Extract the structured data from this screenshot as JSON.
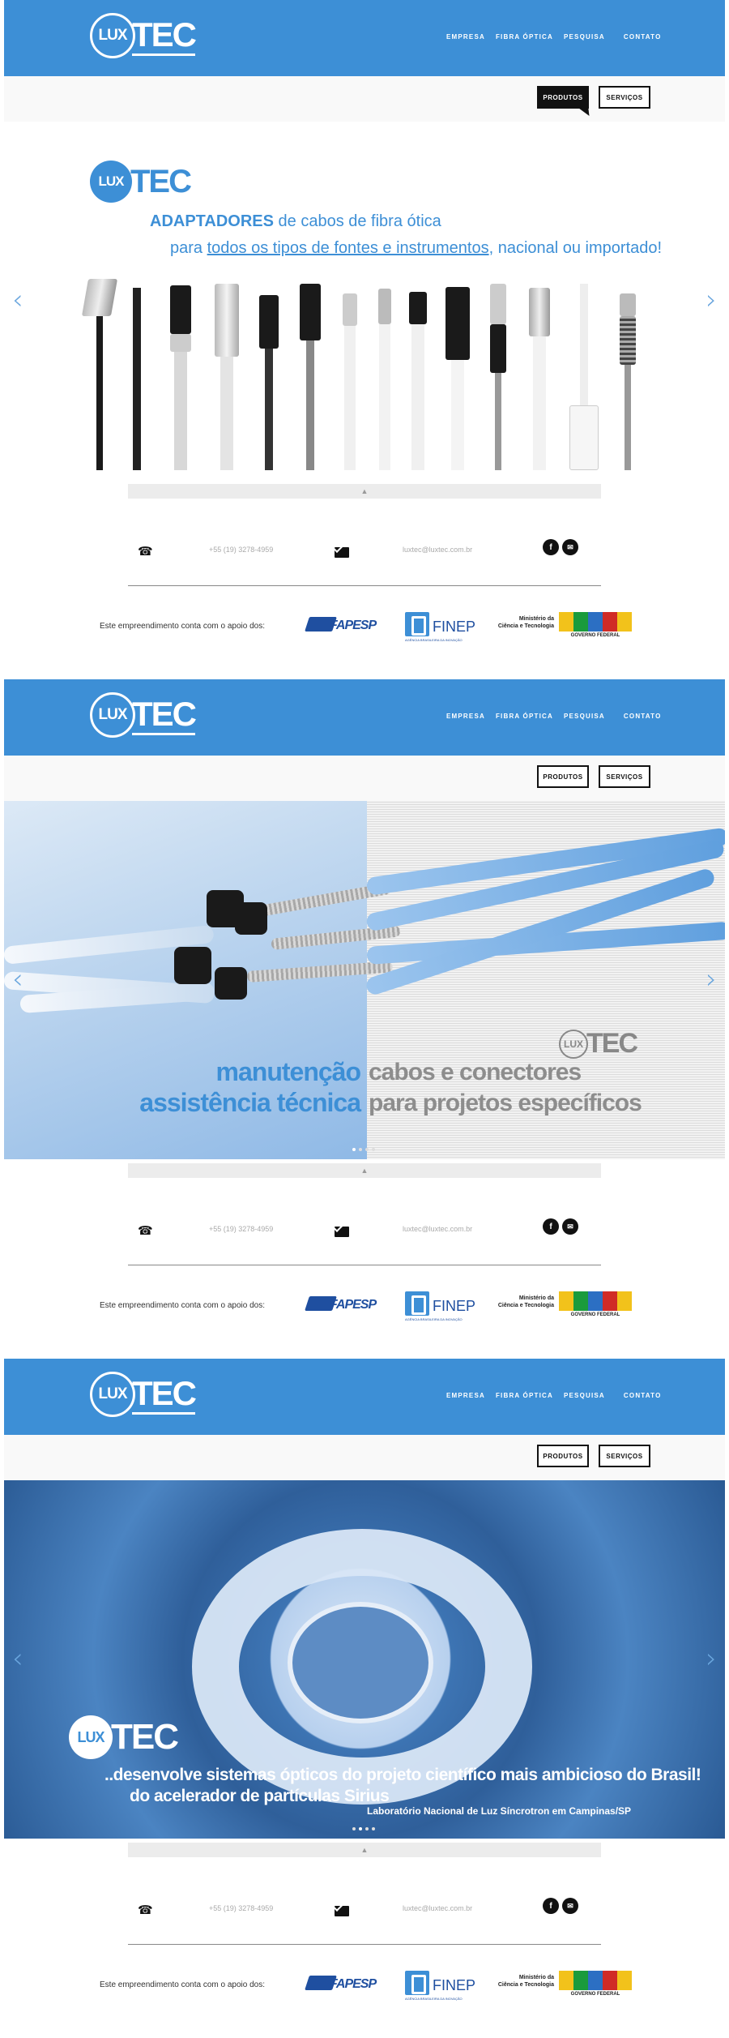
{
  "brand": {
    "logo_lux": "LUX",
    "logo_tec": "TEC"
  },
  "nav": [
    {
      "label": "EMPRESA"
    },
    {
      "label": "FIBRA ÓPTICA"
    },
    {
      "label": "PESQUISA"
    },
    {
      "label": "CONTATO"
    }
  ],
  "buttons": {
    "produtos": "PRODUTOS",
    "servicos": "SERVIÇOS"
  },
  "slides": {
    "s1": {
      "line1_bold": "ADAPTADORES",
      "line1_rest": " de cabos de fibra ótica",
      "line2_pre": "para ",
      "line2_u1": "todos os tipos de fontes e instrumentos",
      "line2_rest": ", nacional ou importado!"
    },
    "s2": {
      "blue1": "manutenção",
      "blue2": "assistência técnica",
      "gray1": "cabos e conectores",
      "gray2": "para projetos específicos"
    },
    "s3": {
      "line1": "..desenvolve sistemas ópticos do projeto científico mais ambicioso do Brasil!",
      "line2": "do acelerador de partículas Sirius",
      "line3": "Laboratório Nacional de Luz Síncrotron em Campinas/SP"
    }
  },
  "arrows": {
    "prev": "‹",
    "next": "›",
    "collapse": "▲"
  },
  "contact": {
    "phone": "+55 (19) 3278-4959",
    "email": "luxtec@luxtec.com.br",
    "phone_icon": "☎",
    "facebook": "f",
    "mail_social": "✉"
  },
  "sponsors": {
    "text": "Este empreendimento conta com o apoio dos:",
    "fapesp": "FAPESP",
    "finep": "FINEP",
    "finep_sub": "AGÊNCIA BRASILEIRA DA INOVAÇÃO",
    "mct_line1": "Ministério da",
    "mct_line2": "Ciência e Tecnologia",
    "governo": "GOVERNO FEDERAL"
  },
  "colors": {
    "brand_blue": "#3d8fd6",
    "dark": "#111111"
  }
}
